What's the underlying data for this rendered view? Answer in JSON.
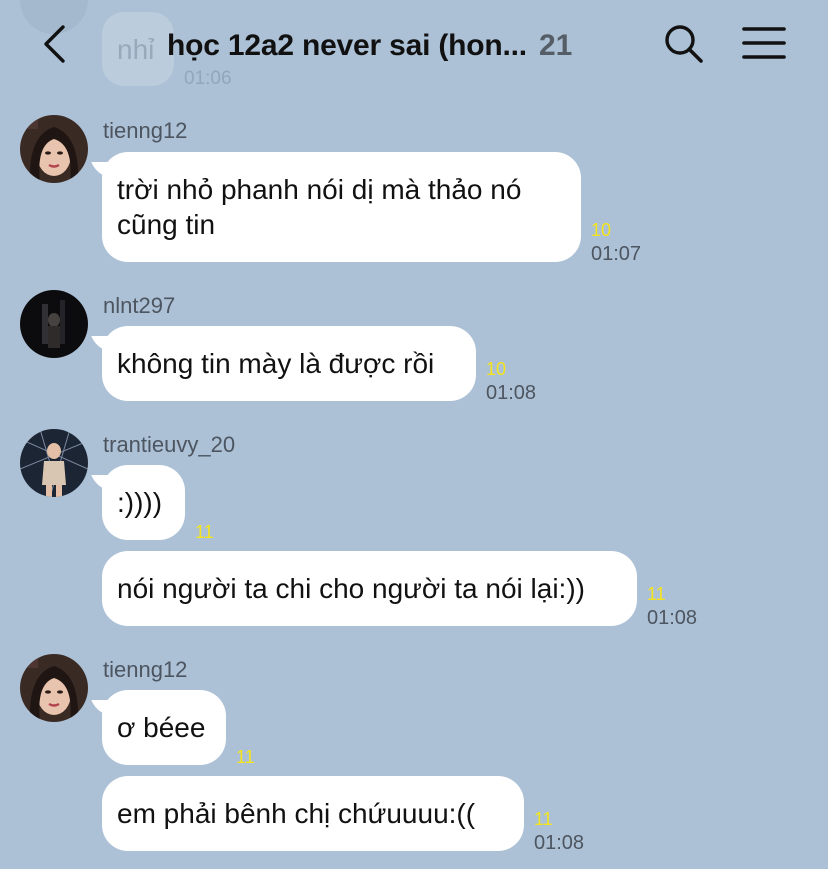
{
  "header": {
    "title": "học 12a2 never sai (hon...",
    "member_count": "21",
    "back_icon": "chevron-left-icon",
    "search_icon": "search-icon",
    "menu_icon": "hamburger-menu-icon"
  },
  "previous_message": {
    "text": "nhỉ",
    "time": "01:06"
  },
  "messages": [
    {
      "sender": "tienng12",
      "bubbles": [
        {
          "text": "trời nhỏ phanh nói dị mà thảo nó\ncũng tin",
          "read_count": "10",
          "time": "01:07"
        }
      ]
    },
    {
      "sender": "nlnt297",
      "bubbles": [
        {
          "text": "không tin mày là được rồi",
          "read_count": "10",
          "time": "01:08"
        }
      ]
    },
    {
      "sender": "trantieuvy_20",
      "bubbles": [
        {
          "text": ":))))",
          "read_count": "11"
        },
        {
          "text": "nói người ta chi cho người ta nói lại:))",
          "read_count": "11",
          "time": "01:08"
        }
      ]
    },
    {
      "sender": "tienng12",
      "bubbles": [
        {
          "text": "ơ béee",
          "read_count": "11"
        },
        {
          "text": "em phải bênh chị chứuuuu:((",
          "read_count": "11",
          "time": "01:08"
        }
      ]
    }
  ],
  "colors": {
    "background": "#acc1d6",
    "bubble": "#ffffff",
    "read_count": "#f5e41c",
    "meta_text": "#4d5560"
  }
}
